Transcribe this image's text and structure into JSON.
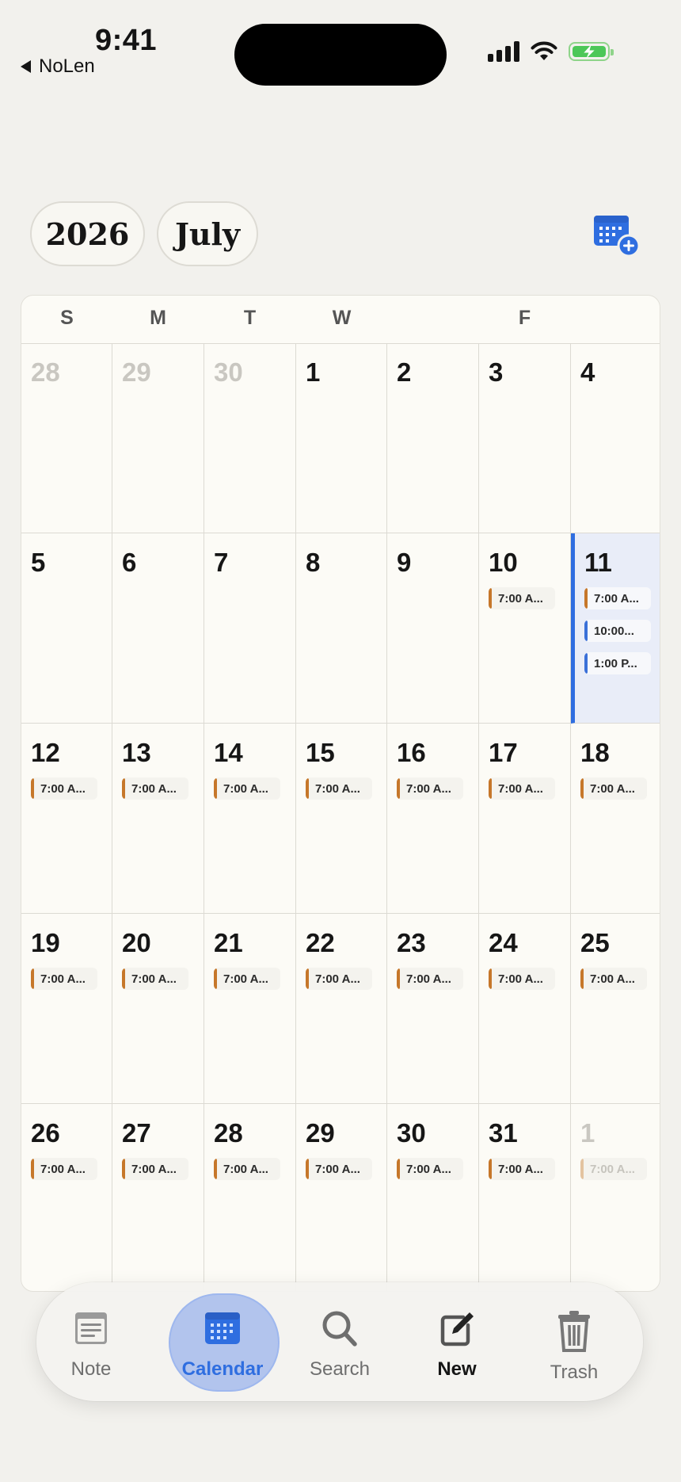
{
  "status_bar": {
    "time": "9:41",
    "back_app": "NoLen"
  },
  "header": {
    "year": "2026",
    "month": "July"
  },
  "calendar": {
    "weekdays": [
      "S",
      "M",
      "T",
      "W",
      "",
      "F",
      ""
    ],
    "weeks": [
      [
        {
          "day": "28",
          "outside": true,
          "events": []
        },
        {
          "day": "29",
          "outside": true,
          "events": []
        },
        {
          "day": "30",
          "outside": true,
          "events": []
        },
        {
          "day": "1",
          "events": []
        },
        {
          "day": "2",
          "events": []
        },
        {
          "day": "3",
          "events": []
        },
        {
          "day": "4",
          "events": []
        }
      ],
      [
        {
          "day": "5",
          "events": []
        },
        {
          "day": "6",
          "events": []
        },
        {
          "day": "7",
          "events": []
        },
        {
          "day": "8",
          "events": []
        },
        {
          "day": "9",
          "events": []
        },
        {
          "day": "10",
          "events": [
            {
              "label": "7:00 A...",
              "color": "orange"
            }
          ]
        },
        {
          "day": "11",
          "today": true,
          "events": [
            {
              "label": "7:00 A...",
              "color": "orange"
            },
            {
              "label": "10:00...",
              "color": "blue"
            },
            {
              "label": "1:00 P...",
              "color": "blue"
            }
          ]
        }
      ],
      [
        {
          "day": "12",
          "events": [
            {
              "label": "7:00 A...",
              "color": "orange"
            }
          ]
        },
        {
          "day": "13",
          "events": [
            {
              "label": "7:00 A...",
              "color": "orange"
            }
          ]
        },
        {
          "day": "14",
          "events": [
            {
              "label": "7:00 A...",
              "color": "orange"
            }
          ]
        },
        {
          "day": "15",
          "events": [
            {
              "label": "7:00 A...",
              "color": "orange"
            }
          ]
        },
        {
          "day": "16",
          "events": [
            {
              "label": "7:00 A...",
              "color": "orange"
            }
          ]
        },
        {
          "day": "17",
          "events": [
            {
              "label": "7:00 A...",
              "color": "orange"
            }
          ]
        },
        {
          "day": "18",
          "events": [
            {
              "label": "7:00 A...",
              "color": "orange"
            }
          ]
        }
      ],
      [
        {
          "day": "19",
          "events": [
            {
              "label": "7:00 A...",
              "color": "orange"
            }
          ]
        },
        {
          "day": "20",
          "events": [
            {
              "label": "7:00 A...",
              "color": "orange"
            }
          ]
        },
        {
          "day": "21",
          "events": [
            {
              "label": "7:00 A...",
              "color": "orange"
            }
          ]
        },
        {
          "day": "22",
          "events": [
            {
              "label": "7:00 A...",
              "color": "orange"
            }
          ]
        },
        {
          "day": "23",
          "events": [
            {
              "label": "7:00 A...",
              "color": "orange"
            }
          ]
        },
        {
          "day": "24",
          "events": [
            {
              "label": "7:00 A...",
              "color": "orange"
            }
          ]
        },
        {
          "day": "25",
          "events": [
            {
              "label": "7:00 A...",
              "color": "orange"
            }
          ]
        }
      ],
      [
        {
          "day": "26",
          "events": [
            {
              "label": "7:00 A...",
              "color": "orange"
            }
          ]
        },
        {
          "day": "27",
          "events": [
            {
              "label": "7:00 A...",
              "color": "orange"
            }
          ]
        },
        {
          "day": "28",
          "events": [
            {
              "label": "7:00 A...",
              "color": "orange"
            }
          ]
        },
        {
          "day": "29",
          "events": [
            {
              "label": "7:00 A...",
              "color": "orange"
            }
          ]
        },
        {
          "day": "30",
          "events": [
            {
              "label": "7:00 A...",
              "color": "orange"
            }
          ]
        },
        {
          "day": "31",
          "events": [
            {
              "label": "7:00 A...",
              "color": "orange"
            }
          ]
        },
        {
          "day": "1",
          "outside": true,
          "events": [
            {
              "label": "7:00 A...",
              "color": "orange"
            }
          ]
        }
      ]
    ]
  },
  "tabbar": {
    "tabs": [
      {
        "label": "Note",
        "icon": "note-icon"
      },
      {
        "label": "Calendar",
        "icon": "calendar-icon",
        "active": true
      },
      {
        "label": "Search",
        "icon": "search-icon"
      },
      {
        "label": "New",
        "icon": "compose-icon"
      },
      {
        "label": "Trash",
        "icon": "trash-icon"
      }
    ]
  },
  "colors": {
    "accent": "#2f6ee0",
    "event_orange": "#c6772a",
    "event_blue": "#3a70d8",
    "today_bg": "#e9edf8",
    "battery": "#4cc758"
  }
}
